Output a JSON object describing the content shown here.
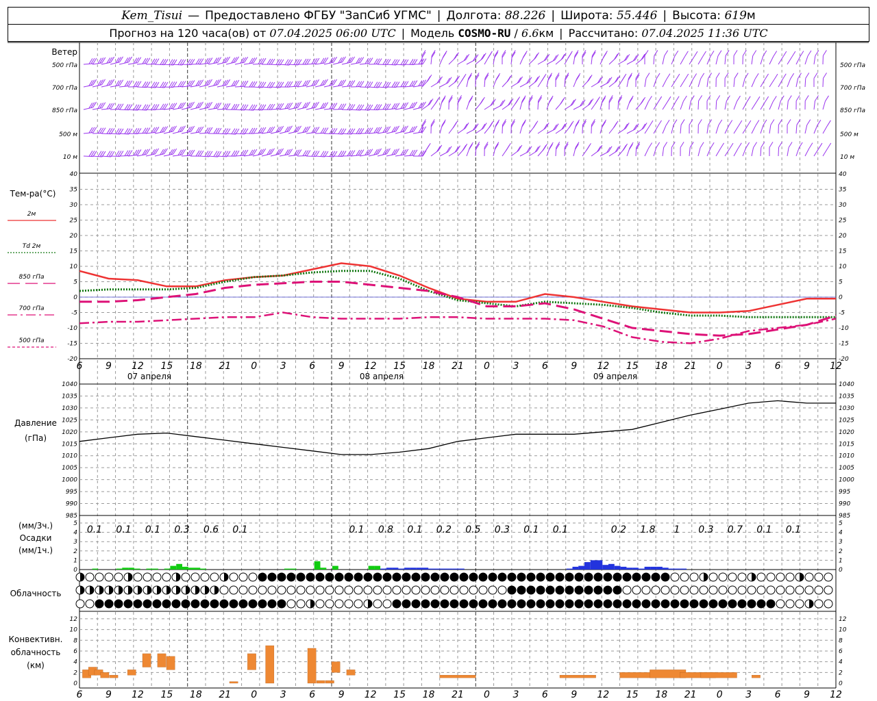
{
  "header": {
    "station": "Kem_Tisui",
    "provider": "Предоставлено ФГБУ \"ЗапСиб УГМС\"",
    "lon_label": "Долгота:",
    "lon_value": "88.226",
    "lat_label": "Широта:",
    "lat_value": "55.446",
    "alt_label": "Высота:",
    "alt_value": "619",
    "alt_unit": "м",
    "forecast_label": "Прогноз на 120 часа(ов) от",
    "forecast_start": "07.04.2025 06:00 UTC",
    "model_label": "Модель",
    "model_name": "COSMO-RU",
    "model_res": "6.6",
    "res_unit": "км",
    "calc_label": "Рассчитано:",
    "calc_time": "07.04.2025 11:36 UTC"
  },
  "colors": {
    "wind": "#9933ee",
    "t2m": "#ee3333",
    "td2m": "#117711",
    "t850": "#dd1177",
    "t700": "#dd1177",
    "t500": "#dd1177",
    "pressure": "#000000",
    "precip_green": "#11cc11",
    "precip_blue": "#2233dd",
    "conv_cloud": "#ee8833",
    "grid": "#999999"
  },
  "chart_data": [
    {
      "type": "wind-barbs",
      "title": "Ветер",
      "levels": [
        "500 гПа",
        "700 гПа",
        "850 гПа",
        "500 м",
        "10 м"
      ]
    },
    {
      "type": "line",
      "ylabel": "Тем-ра(°C)",
      "ylim": [
        -20,
        40
      ],
      "yticks": [
        -20,
        -15,
        -10,
        -5,
        0,
        5,
        10,
        15,
        20,
        25,
        30,
        35,
        40
      ],
      "x_hours": [
        6,
        9,
        12,
        15,
        18,
        21,
        0,
        3,
        6,
        9,
        12,
        15,
        18,
        21,
        0,
        3,
        6,
        9,
        12,
        15,
        18,
        21,
        0,
        3,
        6,
        9,
        12
      ],
      "day_labels": [
        "07 апреля",
        "08 апреля",
        "09 апреля"
      ],
      "series": [
        {
          "name": "2м",
          "values": [
            8.5,
            6,
            5.5,
            3.5,
            3.5,
            5.5,
            6.5,
            7,
            9,
            11,
            10,
            7,
            3,
            -0.5,
            -1.5,
            -1.5,
            1,
            0,
            -1.5,
            -3,
            -4,
            -5,
            -5,
            -4.5,
            -2.5,
            -0.5,
            -0.5
          ]
        },
        {
          "name": "Td 2м",
          "values": [
            2,
            2.5,
            2.5,
            2.5,
            3,
            5,
            6.5,
            7,
            8,
            8.5,
            8.5,
            6,
            2,
            -1,
            -2,
            -3,
            -1.5,
            -2,
            -2.5,
            -3.5,
            -5,
            -6,
            -6,
            -6.5,
            -6.5,
            -6.5,
            -6.5
          ]
        },
        {
          "name": "850 гПа",
          "values": [
            -1.5,
            -1.5,
            -1,
            0,
            1,
            3,
            4,
            4.5,
            5,
            5,
            4,
            3,
            2,
            0,
            -3,
            -3,
            -2,
            -4,
            -7,
            -10,
            -11,
            -12,
            -12.5,
            -12,
            -10.5,
            -9,
            -6
          ]
        },
        {
          "name": "700 гПа",
          "values": [
            -8.5,
            -8,
            -8,
            -7.5,
            -7,
            -6.5,
            -6.5,
            -5,
            -6.5,
            -7,
            -7,
            -7,
            -6.5,
            -6.5,
            -7,
            -7,
            -7,
            -7.5,
            -9.5,
            -13,
            -14.5,
            -15,
            -13.5,
            -11,
            -10,
            -9,
            -7
          ]
        },
        {
          "name": "500 гПа",
          "values": []
        }
      ]
    },
    {
      "type": "line",
      "ylabel": "Давление",
      "yunit": "(гПа)",
      "ylim": [
        985,
        1040
      ],
      "yticks": [
        985,
        990,
        995,
        1000,
        1005,
        1010,
        1015,
        1020,
        1025,
        1030,
        1035,
        1040
      ],
      "series": [
        {
          "name": "",
          "values": [
            1016,
            1017.5,
            1019,
            1019.5,
            1018,
            1016.5,
            1015,
            1013.5,
            1012,
            1010.5,
            1010.5,
            1011.5,
            1013,
            1016,
            1017.5,
            1019,
            1019,
            1019,
            1020,
            1021,
            1024,
            1027,
            1029.5,
            1032,
            1033,
            1032,
            1032
          ]
        }
      ]
    },
    {
      "type": "bar",
      "ylabel": "Осадки",
      "yunit_top": "(мм/3ч.)",
      "yunit_bottom": "(мм/1ч.)",
      "ylim": [
        0,
        5
      ],
      "yticks": [
        0,
        1,
        2,
        3,
        4,
        5
      ],
      "totals_3h": [
        "0.1",
        "0.1",
        "0.1",
        "0.3",
        "0.6",
        "0.1",
        "",
        "",
        "",
        "0.1",
        "0.8",
        "0.1",
        "0.2",
        "0.5",
        "0.3",
        "0.1",
        "0.1",
        "",
        "0.2",
        "1.8",
        "1",
        "0.3",
        "0.7",
        "0.1",
        "0.1",
        "",
        ""
      ],
      "hourly_green": [
        0,
        0,
        0.1,
        0,
        0,
        0,
        0.1,
        0.2,
        0.2,
        0.1,
        0,
        0.1,
        0.1,
        0,
        0.1,
        0.4,
        0.6,
        0.3,
        0.2,
        0.2,
        0.1,
        0,
        0,
        0,
        0,
        0,
        0,
        0,
        0,
        0,
        0,
        0,
        0,
        0,
        0.1,
        0.1,
        0,
        0,
        0,
        0.9,
        0.2,
        0,
        0.4,
        0,
        0,
        0,
        0,
        0,
        0.4,
        0.4,
        0,
        0,
        0,
        0,
        0,
        0,
        0
      ],
      "hourly_blue": [
        0,
        0,
        0,
        0,
        0,
        0,
        0,
        0,
        0,
        0,
        0,
        0,
        0,
        0,
        0,
        0,
        0,
        0,
        0,
        0,
        0,
        0,
        0,
        0,
        0,
        0,
        0,
        0,
        0,
        0,
        0,
        0,
        0,
        0,
        0,
        0,
        0,
        0,
        0,
        0,
        0,
        0,
        0,
        0,
        0,
        0,
        0,
        0,
        0,
        0,
        0.1,
        0.2,
        0.2,
        0.1,
        0.2,
        0.2,
        0.2,
        0.2,
        0.1,
        0.1,
        0.1,
        0.1,
        0.1,
        0.1,
        0,
        0,
        0,
        0,
        0,
        0,
        0,
        0,
        0,
        0,
        0,
        0,
        0,
        0,
        0,
        0,
        0,
        0.1,
        0.3,
        0.4,
        0.8,
        1,
        1,
        0.5,
        0.6,
        0.4,
        0.3,
        0.2,
        0.2,
        0.1,
        0.3,
        0.3,
        0.3,
        0.2,
        0.1,
        0.1,
        0.1,
        0,
        0
      ]
    },
    {
      "type": "cloud-symbols",
      "ylabel": "Облачность",
      "rows": 3
    },
    {
      "type": "bar",
      "ylabel": "Конвективн. облачность (км)",
      "ylim": [
        0,
        13
      ],
      "yticks": [
        0,
        2,
        4,
        6,
        8,
        10,
        12
      ],
      "segments": [
        {
          "t": 0.5,
          "lo": 1,
          "hi": 2.5
        },
        {
          "t": 1.5,
          "lo": 1.5,
          "hi": 3
        },
        {
          "t": 2.5,
          "lo": 1.5,
          "hi": 2.5
        },
        {
          "t": 3.5,
          "lo": 1,
          "hi": 2
        },
        {
          "t": 5,
          "lo": 1,
          "hi": 1.5
        },
        {
          "t": 8,
          "lo": 1.5,
          "hi": 2.5
        },
        {
          "t": 10.5,
          "lo": 3,
          "hi": 5.5
        },
        {
          "t": 13,
          "lo": 3,
          "hi": 5.5
        },
        {
          "t": 14.5,
          "lo": 2.5,
          "hi": 5
        },
        {
          "t": 25,
          "lo": 0,
          "hi": 0.3
        },
        {
          "t": 28,
          "lo": 2.5,
          "hi": 5.5
        },
        {
          "t": 31,
          "lo": 0,
          "hi": 7
        },
        {
          "t": 38,
          "lo": 0,
          "hi": 6.5
        },
        {
          "t": 39.5,
          "lo": 0,
          "hi": 0.5
        },
        {
          "t": 41,
          "lo": 0,
          "hi": 0.5
        },
        {
          "t": 42,
          "lo": 2,
          "hi": 4
        },
        {
          "t": 44.5,
          "lo": 1.5,
          "hi": 2.5
        },
        {
          "t": 60,
          "lo": 1,
          "hi": 1.5
        },
        {
          "t": 80,
          "lo": 1,
          "hi": 1.5
        },
        {
          "t": 90,
          "lo": 1,
          "hi": 2
        },
        {
          "t": 95,
          "lo": 1,
          "hi": 2.5
        },
        {
          "t": 100,
          "lo": 1,
          "hi": 2
        },
        {
          "t": 103.5,
          "lo": 1,
          "hi": 2
        },
        {
          "t": 112,
          "lo": 1,
          "hi": 1.5
        }
      ]
    }
  ]
}
